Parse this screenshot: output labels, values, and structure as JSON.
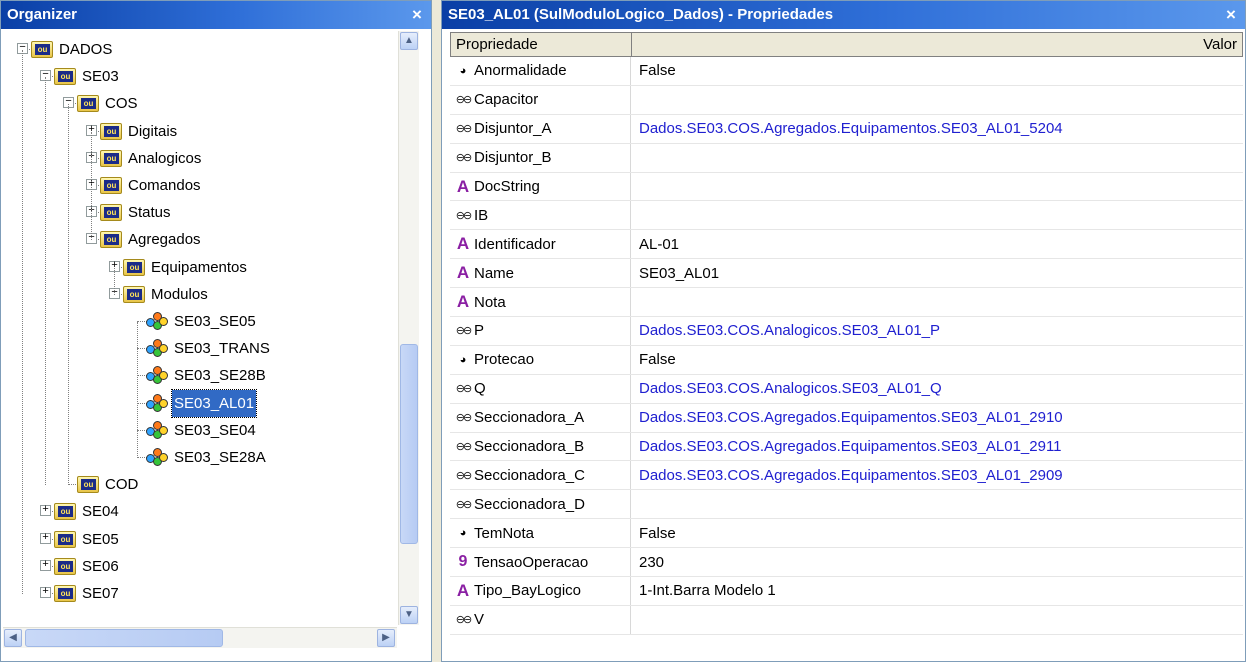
{
  "organizer": {
    "title": "Organizer",
    "close": "×",
    "tree": [
      {
        "label": "DADOS",
        "level": 1,
        "expander": "−",
        "icon": "folder"
      },
      {
        "label": "SE03",
        "level": 2,
        "expander": "−",
        "icon": "folder"
      },
      {
        "label": "COS",
        "level": 3,
        "expander": "−",
        "icon": "folder"
      },
      {
        "label": "Digitais",
        "level": 4,
        "expander": "+",
        "icon": "folder"
      },
      {
        "label": "Analogicos",
        "level": 4,
        "expander": "+",
        "icon": "folder"
      },
      {
        "label": "Comandos",
        "level": 4,
        "expander": "+",
        "icon": "folder"
      },
      {
        "label": "Status",
        "level": 4,
        "expander": "+",
        "icon": "folder"
      },
      {
        "label": "Agregados",
        "level": 4,
        "expander": "−",
        "icon": "folder"
      },
      {
        "label": "Equipamentos",
        "level": 5,
        "expander": "+",
        "icon": "folder"
      },
      {
        "label": "Modulos",
        "level": 5,
        "expander": "−",
        "icon": "folder"
      },
      {
        "label": "SE03_SE05",
        "level": 6,
        "expander": "",
        "icon": "module"
      },
      {
        "label": "SE03_TRANS",
        "level": 6,
        "expander": "",
        "icon": "module"
      },
      {
        "label": "SE03_SE28B",
        "level": 6,
        "expander": "",
        "icon": "module"
      },
      {
        "label": "SE03_AL01",
        "level": 6,
        "expander": "",
        "icon": "module",
        "selected": true
      },
      {
        "label": "SE03_SE04",
        "level": 6,
        "expander": "",
        "icon": "module"
      },
      {
        "label": "SE03_SE28A",
        "level": 6,
        "expander": "",
        "icon": "module"
      },
      {
        "label": "COD",
        "level": 3,
        "expander": "",
        "icon": "folder"
      },
      {
        "label": "SE04",
        "level": 2,
        "expander": "+",
        "icon": "folder"
      },
      {
        "label": "SE05",
        "level": 2,
        "expander": "+",
        "icon": "folder"
      },
      {
        "label": "SE06",
        "level": 2,
        "expander": "+",
        "icon": "folder"
      },
      {
        "label": "SE07",
        "level": 2,
        "expander": "+",
        "icon": "folder"
      }
    ],
    "folder_icon_text": "ou",
    "scroll_up": "▲",
    "scroll_down": "▼",
    "scroll_left": "◀",
    "scroll_right": "▶"
  },
  "properties": {
    "title": "SE03_AL01 (SulModuloLogico_Dados) - Propriedades",
    "close": "×",
    "col_property": "Propriedade",
    "col_value": "Valor",
    "rows": [
      {
        "icon": "bool",
        "name": "Anormalidade",
        "value": "False",
        "link": false
      },
      {
        "icon": "chain",
        "name": "Capacitor",
        "value": "",
        "link": false
      },
      {
        "icon": "chain",
        "name": "Disjuntor_A",
        "value": "Dados.SE03.COS.Agregados.Equipamentos.SE03_AL01_5204",
        "link": true
      },
      {
        "icon": "chain",
        "name": "Disjuntor_B",
        "value": "",
        "link": false
      },
      {
        "icon": "str",
        "name": "DocString",
        "value": "",
        "link": false
      },
      {
        "icon": "chain",
        "name": "IB",
        "value": "",
        "link": false
      },
      {
        "icon": "str",
        "name": "Identificador",
        "value": "AL-01",
        "link": false
      },
      {
        "icon": "str",
        "name": "Name",
        "value": "SE03_AL01",
        "link": false
      },
      {
        "icon": "str",
        "name": "Nota",
        "value": "",
        "link": false
      },
      {
        "icon": "chain",
        "name": "P",
        "value": "Dados.SE03.COS.Analogicos.SE03_AL01_P",
        "link": true
      },
      {
        "icon": "bool",
        "name": "Protecao",
        "value": "False",
        "link": false
      },
      {
        "icon": "chain",
        "name": "Q",
        "value": "Dados.SE03.COS.Analogicos.SE03_AL01_Q",
        "link": true
      },
      {
        "icon": "chain",
        "name": "Seccionadora_A",
        "value": "Dados.SE03.COS.Agregados.Equipamentos.SE03_AL01_2910",
        "link": true
      },
      {
        "icon": "chain",
        "name": "Seccionadora_B",
        "value": "Dados.SE03.COS.Agregados.Equipamentos.SE03_AL01_2911",
        "link": true
      },
      {
        "icon": "chain",
        "name": "Seccionadora_C",
        "value": "Dados.SE03.COS.Agregados.Equipamentos.SE03_AL01_2909",
        "link": true
      },
      {
        "icon": "chain",
        "name": "Seccionadora_D",
        "value": "",
        "link": false
      },
      {
        "icon": "bool",
        "name": "TemNota",
        "value": "False",
        "link": false
      },
      {
        "icon": "num",
        "name": "TensaoOperacao",
        "value": "230",
        "link": false
      },
      {
        "icon": "str",
        "name": "Tipo_BayLogico",
        "value": "1-Int.Barra Modelo 1",
        "link": false
      },
      {
        "icon": "chain",
        "name": "V",
        "value": "",
        "link": false
      }
    ],
    "icon_glyphs": {
      "bool": "◕",
      "chain": "⊖⊖",
      "str": "A",
      "num": "9"
    }
  }
}
